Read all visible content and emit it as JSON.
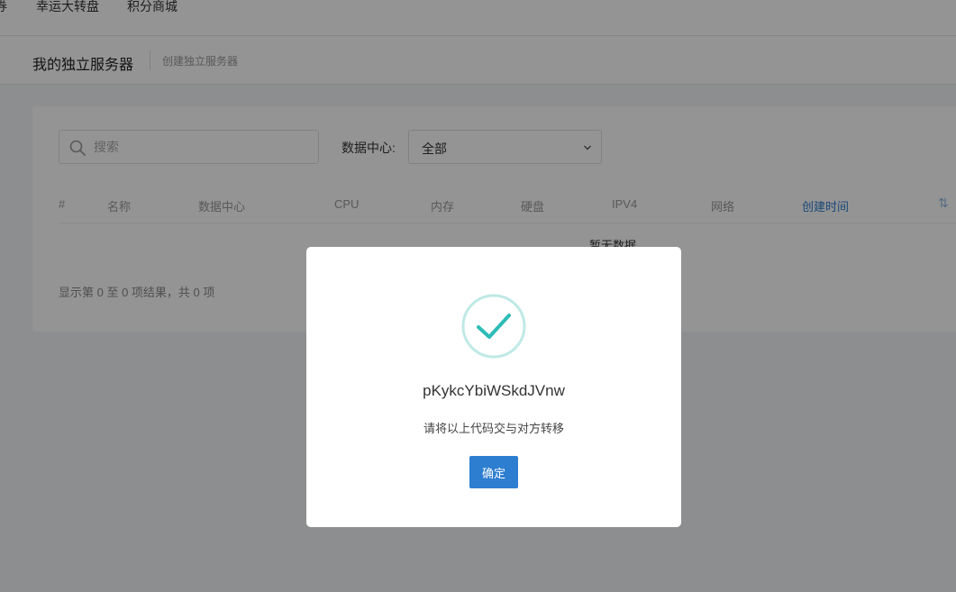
{
  "topnav": {
    "items": [
      {
        "label": "券"
      },
      {
        "label": "幸运大转盘"
      },
      {
        "label": "积分商城"
      }
    ]
  },
  "subheader": {
    "title": "我的独立服务器",
    "create_link": "创建独立服务器"
  },
  "filters": {
    "search_placeholder": "搜索",
    "datacenter_label": "数据中心:",
    "datacenter_value": "全部"
  },
  "table": {
    "columns": [
      "#",
      "名称",
      "数据中心",
      "CPU",
      "内存",
      "硬盘",
      "IPV4",
      "网络",
      "创建时间"
    ],
    "sort_column": "创建时间",
    "empty_text": "暂无数据",
    "result_info": "显示第 0 至 0 项结果，共 0 项"
  },
  "modal": {
    "icon": "check-circle-icon",
    "code": "pKykcYbiWSkdJVnw",
    "message": "请将以上代码交与对方转移",
    "ok_label": "确定"
  },
  "colors": {
    "accent": "#2d7ed0",
    "success": "#2ebcb8",
    "success_ring": "#bfe9e6"
  }
}
